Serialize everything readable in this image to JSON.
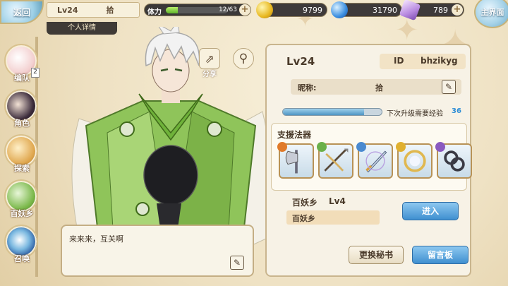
{
  "topbar": {
    "back_label": "返回",
    "level": "Lv24",
    "name": "拾",
    "stamina_label": "体力",
    "stamina_value": "12/63",
    "stamina_fraction": 0.19,
    "gold": "9799",
    "gems": "31790",
    "crystals": "789",
    "main_label": "主界面",
    "plus": "+"
  },
  "detail_tab": "个人详情",
  "sidebar": {
    "items": [
      {
        "label": "编队",
        "badge": "2"
      },
      {
        "label": "角色"
      },
      {
        "label": "探索"
      },
      {
        "label": "百妖乡"
      },
      {
        "label": "召唤"
      }
    ]
  },
  "share_label": "分享",
  "dialog": {
    "text": "来来来，互关啊"
  },
  "profile": {
    "level": "Lv24",
    "id_key": "ID",
    "id_value": "bhzikyg",
    "nick_key": "昵称:",
    "nick_value": "拾",
    "exp_label": "下次升级需要经验",
    "exp_value": "36",
    "exp_fraction": 0.82
  },
  "support": {
    "title": "支援法器",
    "weapons": [
      {
        "icon": "axe-icon",
        "tag_color": "#e07a2a"
      },
      {
        "icon": "crossbow-icon",
        "tag_color": "#6ab04a"
      },
      {
        "icon": "sword-icon",
        "tag_color": "#4a8ad0"
      },
      {
        "icon": "ring-icon",
        "tag_color": "#e0b030"
      },
      {
        "icon": "chain-icon",
        "tag_color": "#8a5ac0"
      }
    ]
  },
  "village": {
    "name": "百妖乡",
    "level": "Lv4",
    "value": "百妖乡",
    "enter_label": "进入"
  },
  "buttons": {
    "swap_secretary": "更换秘书",
    "message_board": "留言板"
  }
}
